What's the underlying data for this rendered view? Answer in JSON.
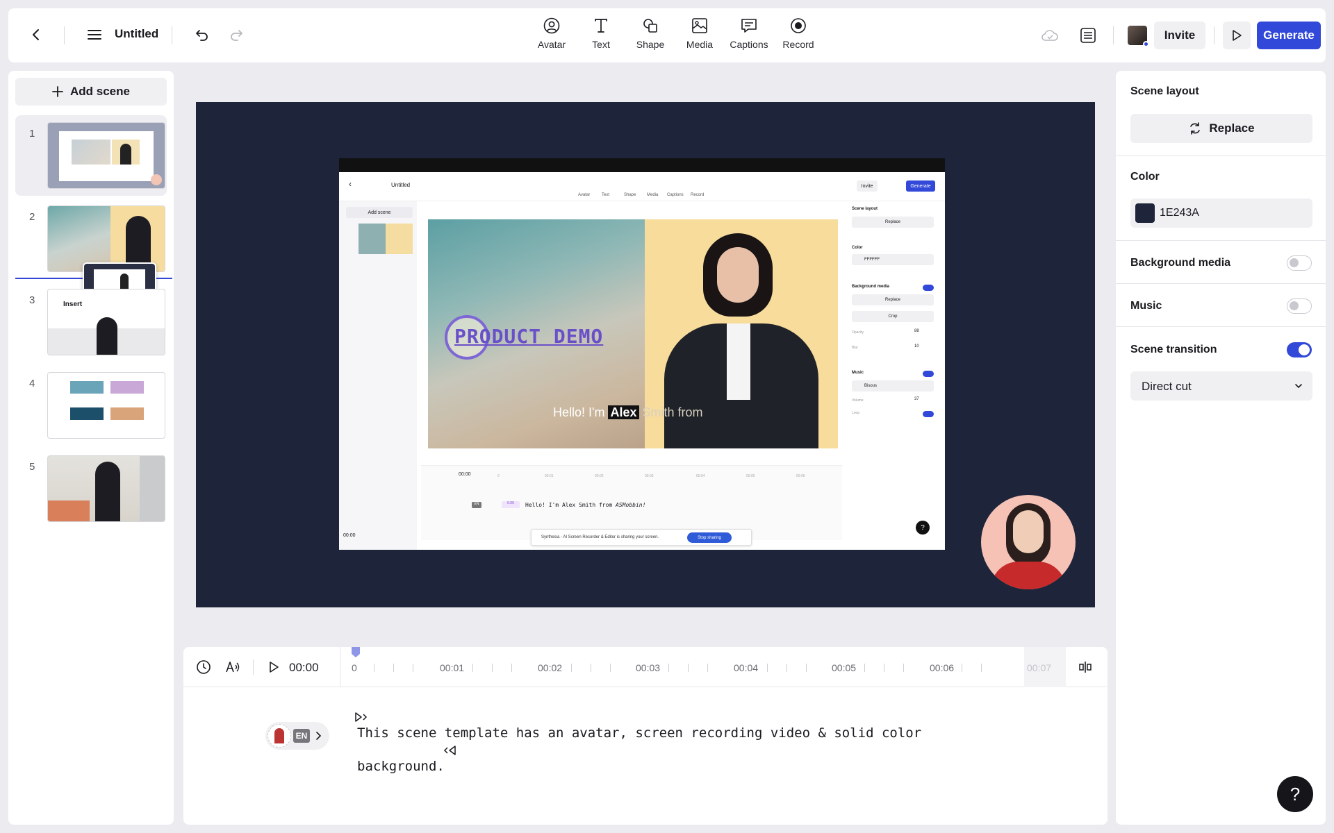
{
  "topbar": {
    "title": "Untitled",
    "tools": [
      {
        "label": "Avatar",
        "icon": "avatar-icon"
      },
      {
        "label": "Text",
        "icon": "text-icon"
      },
      {
        "label": "Shape",
        "icon": "shape-icon"
      },
      {
        "label": "Media",
        "icon": "media-icon"
      },
      {
        "label": "Captions",
        "icon": "captions-icon"
      },
      {
        "label": "Record",
        "icon": "record-icon"
      }
    ],
    "invite_label": "Invite",
    "generate_label": "Generate",
    "accent": "#3148d8"
  },
  "left": {
    "add_scene_label": "Add scene",
    "scenes": [
      "1",
      "2",
      "3",
      "4",
      "5"
    ],
    "scene3_text": "Insert"
  },
  "canvas": {
    "background": "#1e243a",
    "caption_pre": "Hello! I'm",
    "caption_highlight": "Alex",
    "caption_post": "Smith from",
    "product_demo": "PRODUCT DEMO",
    "inner": {
      "title": "Untitled",
      "tools": [
        "Avatar",
        "Text",
        "Shape",
        "Media",
        "Captions",
        "Record"
      ],
      "invite": "Invite",
      "generate": "Generate",
      "add_scene": "Add scene",
      "scene_layout": "Scene layout",
      "replace": "Replace",
      "color": "Color",
      "color_value": "FFFFFF",
      "background_media": "Background media",
      "crop": "Crop",
      "opacity_label": "Opacity",
      "opacity_value": "88",
      "blur_label": "Blur",
      "blur_value": "10",
      "music": "Music",
      "track": "Bisous",
      "volume_label": "Volume",
      "volume_value": "37",
      "loop_label": "Loop",
      "time": "00:00",
      "ticks": [
        "0",
        "00:01",
        "00:02",
        "00:03",
        "00:04",
        "00:05",
        "00:06"
      ],
      "script": "Hello! I'm Alex Smith from ",
      "script_italic": "ASMobbin!",
      "share_text": "Synthesia - AI Screen Recorder & Editor is sharing your screen.",
      "stop_sharing": "Stop sharing",
      "rec_time": "00:00",
      "lang": "EN",
      "badge": "0.00"
    }
  },
  "timeline": {
    "time": "00:00",
    "ticks": [
      "0",
      "00:01",
      "00:02",
      "00:03",
      "00:04",
      "00:05",
      "00:06",
      "00:07"
    ],
    "language": "EN",
    "script_line1": "This scene template has an avatar, screen recording video & solid color",
    "script_line2": "background."
  },
  "right": {
    "scene_layout": "Scene layout",
    "replace_label": "Replace",
    "color_label": "Color",
    "color_value": "1E243A",
    "background_media_label": "Background media",
    "background_media_on": false,
    "music_label": "Music",
    "music_on": false,
    "scene_transition_label": "Scene transition",
    "scene_transition_on": true,
    "transition_value": "Direct cut"
  },
  "help_label": "?"
}
